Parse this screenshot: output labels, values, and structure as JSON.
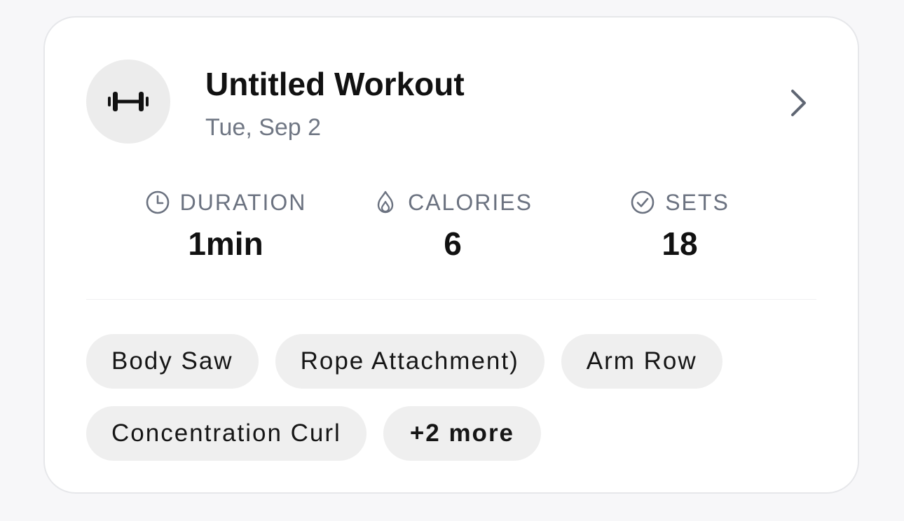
{
  "workout": {
    "title": "Untitled Workout",
    "date": "Tue, Sep 2",
    "icon": "dumbbell-icon"
  },
  "stats": {
    "duration": {
      "label": "DURATION",
      "value": "1min",
      "icon": "clock-icon"
    },
    "calories": {
      "label": "CALORIES",
      "value": "6",
      "icon": "flame-icon"
    },
    "sets": {
      "label": "SETS",
      "value": "18",
      "icon": "check-circle-icon"
    }
  },
  "exercises": {
    "tags": [
      "Body Saw",
      "Rope Attachment)",
      "Arm Row",
      "Concentration Curl"
    ],
    "more_label": "+2 more"
  },
  "colors": {
    "background": "#f7f7f9",
    "card": "#ffffff",
    "card_border": "#e6e7ea",
    "muted_text": "#707784",
    "chip_bg": "#efefef"
  }
}
